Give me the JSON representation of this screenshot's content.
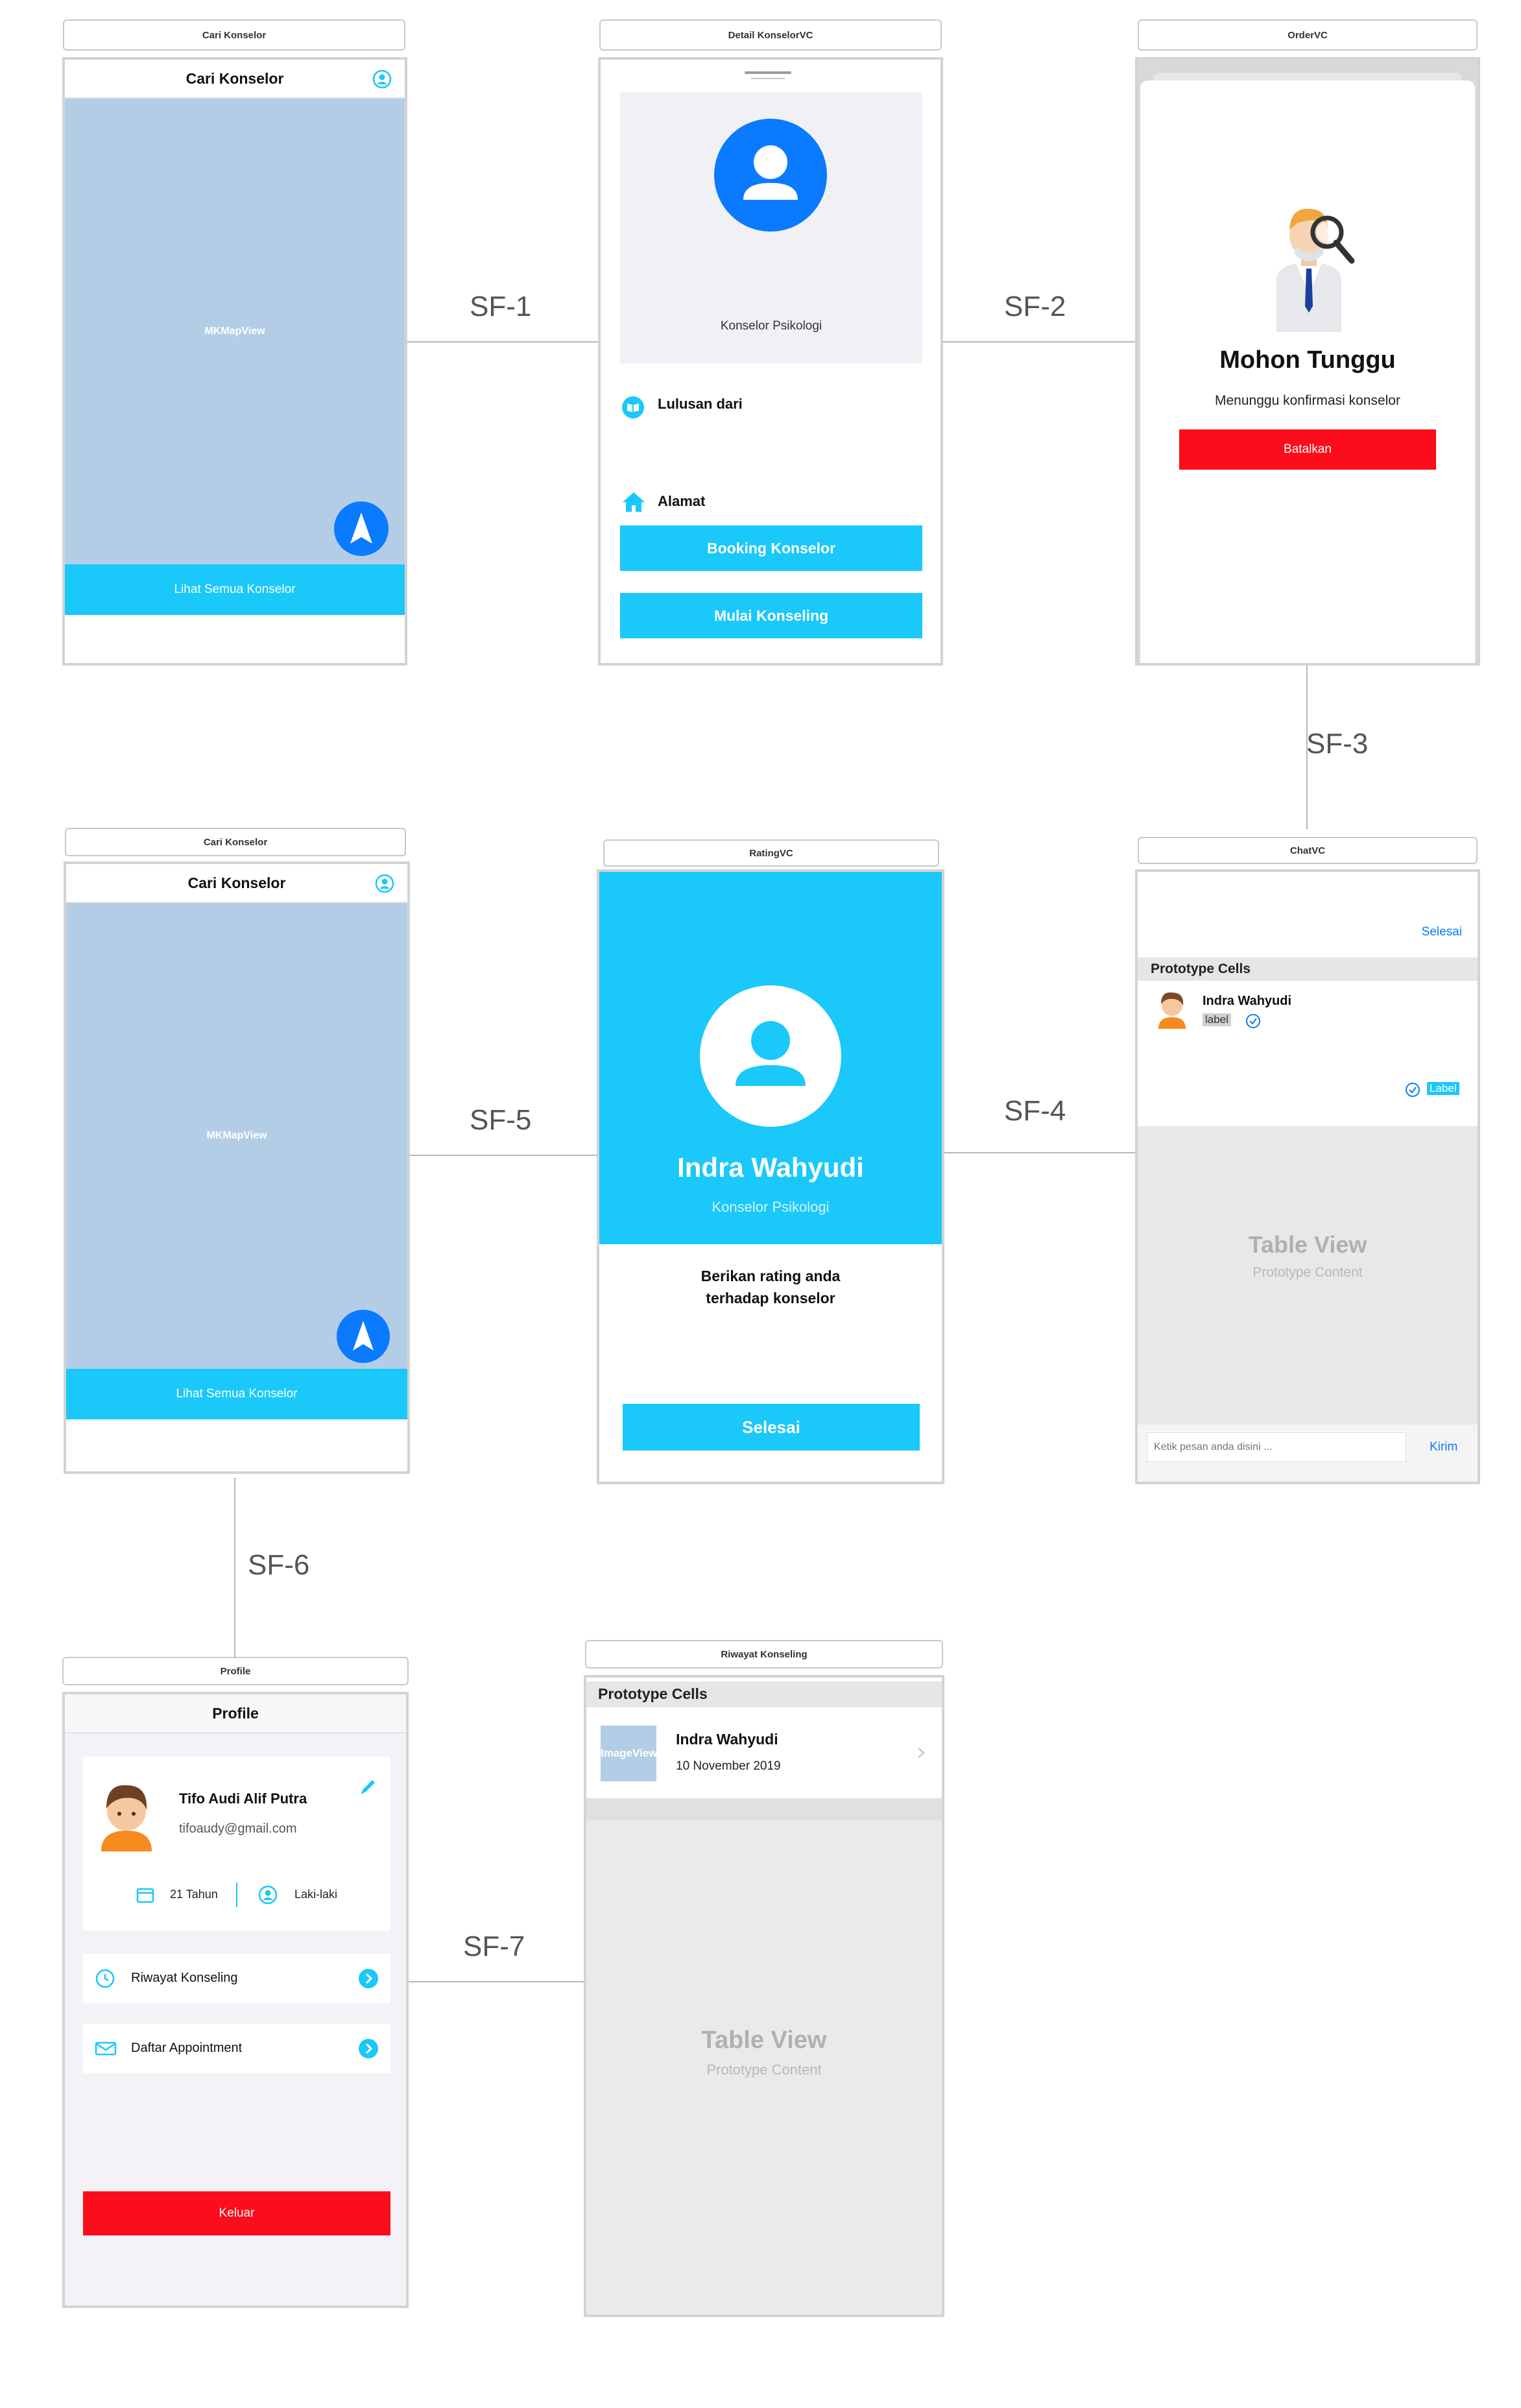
{
  "segues": [
    "SF-1",
    "SF-2",
    "SF-3",
    "SF-4",
    "SF-5",
    "SF-6",
    "SF-7"
  ],
  "scene1": {
    "scene_title": "Cari Konselor",
    "nav_title": "Cari Konselor",
    "map_label": "MKMapView",
    "button": "Lihat Semua Konselor"
  },
  "scene2": {
    "scene_title": "Detail KonselorVC",
    "role": "Konselor Psikologi",
    "lulusan": "Lulusan dari",
    "alamat": "Alamat",
    "booking_button": "Booking Konselor",
    "mulai_button": "Mulai Konseling"
  },
  "scene3": {
    "scene_title": "OrderVC",
    "heading": "Mohon Tunggu",
    "subtitle": "Menunggu konfirmasi konselor",
    "cancel_button": "Batalkan"
  },
  "scene4": {
    "scene_title": "Cari Konselor",
    "nav_title": "Cari Konselor",
    "map_label": "MKMapView",
    "button": "Lihat Semua Konselor"
  },
  "scene5": {
    "scene_title": "RatingVC",
    "name": "Indra Wahyudi",
    "role": "Konselor Psikologi",
    "prompt_line1": "Berikan rating anda",
    "prompt_line2": "terhadap konselor",
    "done_button": "Selesai"
  },
  "scene6": {
    "scene_title": "ChatVC",
    "done_link": "Selesai",
    "section_header": "Prototype Cells",
    "cell_name": "Indra Wahyudi",
    "cell_label": "label",
    "right_label": "Label",
    "table_title": "Table View",
    "table_subtitle": "Prototype Content",
    "input_placeholder": "Ketik pesan anda disini ...",
    "send_button": "Kirim"
  },
  "scene7": {
    "scene_title": "Profile",
    "nav_title": "Profile",
    "name": "Tifo Audi Alif Putra",
    "email": "tifoaudy@gmail.com",
    "age": "21 Tahun",
    "gender": "Laki-laki",
    "menu_history": "Riwayat Konseling",
    "menu_appointment": "Daftar Appointment",
    "logout_button": "Keluar"
  },
  "scene8": {
    "scene_title": "Riwayat Konseling",
    "section_header": "Prototype Cells",
    "image_label": "ImageView",
    "cell_name": "Indra Wahyudi",
    "cell_date": "10 November 2019",
    "table_title": "Table View",
    "table_subtitle": "Prototype Content"
  },
  "colors": {
    "accent_cyan": "#1ac8fa",
    "primary_blue": "#0a7aff",
    "map_blue": "#b4cde7",
    "danger_red": "#fc0d1b"
  }
}
